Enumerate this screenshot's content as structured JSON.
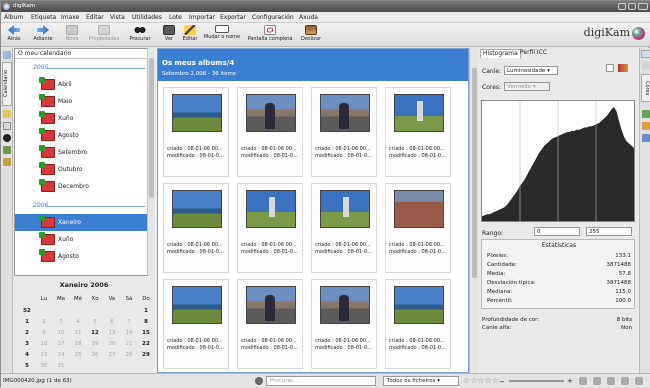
{
  "window": {
    "title": "digiKam"
  },
  "menu": [
    "Álbum",
    "Etiqueta",
    "Imaxe",
    "Editar",
    "Vista",
    "Utilidades",
    "Lote",
    "Importar",
    "Exportar",
    "Configuración",
    "Axuda"
  ],
  "toolbar": [
    {
      "label": "Atrás",
      "icon": "back-arrow-icon",
      "enabled": true
    },
    {
      "label": "Adiante",
      "icon": "forward-arrow-icon",
      "enabled": true
    },
    {
      "label": "Novo",
      "icon": "new-album-icon",
      "enabled": false
    },
    {
      "label": "Propiedades",
      "icon": "properties-icon",
      "enabled": false
    },
    {
      "label": "Procurar",
      "icon": "binoculars-icon",
      "enabled": true
    },
    {
      "label": "Ver",
      "icon": "view-icon",
      "enabled": true
    },
    {
      "label": "Editar",
      "icon": "edit-icon",
      "enabled": true
    },
    {
      "label": "Mudar o nome",
      "icon": "rename-icon",
      "enabled": true
    },
    {
      "label": "Pantalla completa",
      "icon": "fullscreen-icon",
      "enabled": true
    },
    {
      "label": "Deslizar",
      "icon": "slideshow-icon",
      "enabled": true
    }
  ],
  "logo": {
    "text": "digiKam"
  },
  "left_tabs": [
    "Calendario"
  ],
  "left_panel": {
    "title": "O meu calendario",
    "years": [
      "2005",
      "2006"
    ],
    "months_2005": [
      "Abril",
      "Maio",
      "Xuño",
      "Agosto",
      "Setembro",
      "Outubro",
      "Decembro"
    ],
    "months_2006": [
      "Xaneiro",
      "Xuño",
      "Agosto"
    ],
    "selected": "Xaneiro"
  },
  "calendar": {
    "month": "Xaneiro 2006",
    "weekdays": [
      "Lu",
      "Ma",
      "Mé",
      "Xo",
      "Ve",
      "Sá",
      "Do"
    ],
    "rows": [
      {
        "week": "52",
        "days": [
          "",
          "",
          "",
          "",
          "",
          "",
          "1"
        ]
      },
      {
        "week": "1",
        "days": [
          "2",
          "3",
          "4",
          "5",
          "6",
          "7",
          "8"
        ]
      },
      {
        "week": "2",
        "days": [
          "9",
          "10",
          "11",
          "12",
          "13",
          "14",
          "15"
        ]
      },
      {
        "week": "3",
        "days": [
          "16",
          "17",
          "18",
          "19",
          "20",
          "21",
          "22"
        ]
      },
      {
        "week": "4",
        "days": [
          "23",
          "24",
          "25",
          "26",
          "27",
          "28",
          "29"
        ]
      },
      {
        "week": "5",
        "days": [
          "30",
          "31",
          "",
          "",
          "",
          "",
          ""
        ]
      }
    ],
    "bold_days": [
      "1",
      "8",
      "12",
      "15",
      "22",
      "29"
    ]
  },
  "album": {
    "title": "Os meus albums/4",
    "subtitle": "Setembro 2,008 - 36 items",
    "thumb_line1": "criado : 08-01-06 00...",
    "thumb_line2": "modificado : 08-01-0...",
    "thumbs": [
      {
        "scene": "coast"
      },
      {
        "scene": "people"
      },
      {
        "scene": "people"
      },
      {
        "scene": "tower"
      },
      {
        "scene": "coast"
      },
      {
        "scene": "tower"
      },
      {
        "scene": "tower"
      },
      {
        "scene": "path"
      },
      {
        "scene": "coast"
      },
      {
        "scene": "people"
      },
      {
        "scene": "people"
      },
      {
        "scene": "coast"
      }
    ]
  },
  "right_panel": {
    "tabs": [
      "Histograma",
      "Perfil ICC"
    ],
    "channel_label": "Canle:",
    "channel_value": "Luminosidade",
    "colors_label": "Cores:",
    "colors_value": "Vermello",
    "histogram": [
      4,
      5,
      6,
      6,
      7,
      8,
      9,
      10,
      11,
      12,
      14,
      17,
      20,
      23,
      26,
      30,
      33,
      36,
      40,
      44,
      48,
      52,
      56,
      60,
      63,
      66,
      68,
      70,
      72,
      73,
      74,
      75,
      76,
      77,
      78,
      78,
      79,
      79,
      80,
      80,
      81,
      82,
      82,
      83,
      83,
      84,
      85,
      86,
      88,
      90,
      92,
      95,
      98,
      100,
      96,
      88,
      80,
      74,
      70,
      68,
      66,
      64
    ],
    "range_label": "Rango:",
    "range_min": "0",
    "range_max": "255",
    "stats_title": "Estatísticas",
    "stats": [
      {
        "k": "Píxeles:",
        "v": "133.1"
      },
      {
        "k": "Cantidade:",
        "v": "3871488"
      },
      {
        "k": "Media:",
        "v": "57.8"
      },
      {
        "k": "Desviación típica:",
        "v": "3871488"
      },
      {
        "k": "Mediana:",
        "v": "115.0"
      },
      {
        "k": "Percentil:",
        "v": "100.0"
      }
    ],
    "depth_label": "Profundidade de cor:",
    "depth_value": "8 bits",
    "alpha_label": "Canle alfa:",
    "alpha_value": "Non"
  },
  "right_tabs": [
    "Propiedades",
    "Cores",
    "Xeolocalización"
  ],
  "status": {
    "file": "IMG000420.jpg (1 de 63)",
    "search_placeholder": "Procurar...",
    "filter": "Todos os ficheiros",
    "stars": "☆☆☆☆☆"
  }
}
